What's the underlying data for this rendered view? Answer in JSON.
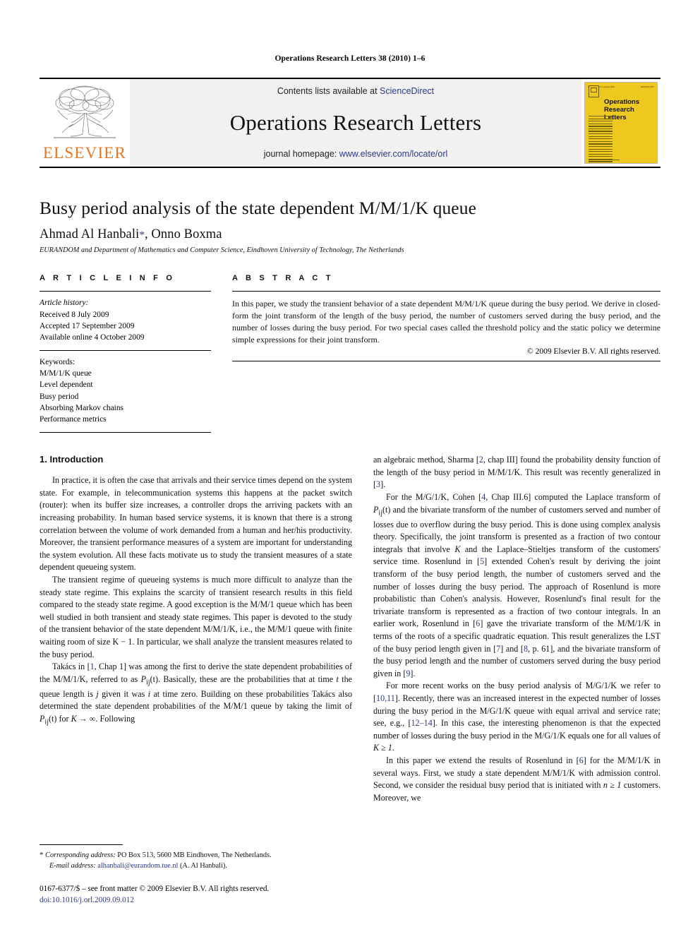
{
  "running_head": "Operations Research Letters 38 (2010) 1–6",
  "masthead": {
    "publisher_wordmark": "ELSEVIER",
    "contents_prefix": "Contents lists available at ",
    "contents_link": "ScienceDirect",
    "journal_title": "Operations Research Letters",
    "homepage_prefix": "journal homepage: ",
    "homepage_link": "www.elsevier.com/locate/orl",
    "cover": {
      "title_line1": "Operations",
      "title_line2": "Research",
      "title_line3": "Letters",
      "top_left": "Volume 38  Issue 1  January 2010",
      "top_right": "ISSN 0167-6377",
      "color": "#EDC81E"
    },
    "accent_orange": "#E87722",
    "link_blue": "#2b3a8f"
  },
  "article": {
    "title": "Busy period analysis of the state dependent M/M/1/K queue",
    "authors": "Ahmad Al Hanbali",
    "author_star": "*",
    "authors_tail": ", Onno Boxma",
    "affiliation": "EURANDOM and Department of Mathematics and Computer Science, Eindhoven University of Technology, The Netherlands"
  },
  "article_info": {
    "heading": "A R T I C L E   I N F O",
    "history_label": "Article history:",
    "history": [
      "Received 8 July 2009",
      "Accepted 17 September 2009",
      "Available online 4 October 2009"
    ],
    "keywords_label": "Keywords:",
    "keywords": [
      "M/M/1/K queue",
      "Level dependent",
      "Busy period",
      "Absorbing Markov chains",
      "Performance metrics"
    ]
  },
  "abstract": {
    "heading": "A B S T R A C T",
    "text": "In this paper, we study the transient behavior of a state dependent M/M/1/K queue during the busy period. We derive in closed-form the joint transform of the length of the busy period, the number of customers served during the busy period, and the number of losses during the busy period. For two special cases called the threshold policy and the static policy we determine simple expressions for their joint transform.",
    "copyright": "© 2009 Elsevier B.V. All rights reserved."
  },
  "body": {
    "section_number_title": "1.  Introduction",
    "left_paragraphs": {
      "p1": "In practice, it is often the case that arrivals and their service times depend on the system state. For example, in telecommunication systems this happens at the packet switch (router): when its buffer size increases, a controller drops the arriving packets with an increasing probability. In human based service systems, it is known that there is a strong correlation between the volume of work demanded from a human and her/his productivity. Moreover, the transient performance measures of a system are important for understanding the system evolution. All these facts motivate us to study the transient measures of a state dependent queueing system.",
      "p2": "The transient regime of queueing systems is much more difficult to analyze than the steady state regime. This explains the scarcity of transient research results in this field compared to the steady state regime. A good exception is the M/M/1 queue which has been well studied in both transient and steady state regimes. This paper is devoted to the study of the transient behavior of the state dependent M/M/1/K, i.e., the M/M/1 queue with finite waiting room of size K − 1. In particular, we shall analyze the transient measures related to the busy period.",
      "p3_a": "Takács in [",
      "p3_ref1": "1",
      "p3_b": ", Chap 1] was among the first to derive the state dependent probabilities of the M/M/1/K, referred to as ",
      "p3_math1": "P",
      "p3_sub1": "ij",
      "p3_math1b": "(t)",
      "p3_c": ". Basically, these are the probabilities that at time ",
      "p3_math2": "t",
      "p3_d": " the queue length is ",
      "p3_math3": "j",
      "p3_e": " given it was ",
      "p3_math4": "i",
      "p3_f": " at time zero. Building on these probabilities Takács also determined the state dependent probabilities of the M/M/1 queue by taking the limit of ",
      "p3_math5": "P",
      "p3_sub5": "ij",
      "p3_math5b": "(t)",
      "p3_g": " for ",
      "p3_math6": "K",
      "p3_arrow": " → ",
      "p3_inf": "∞",
      "p3_h": ". Following"
    },
    "right_paragraphs": {
      "p4_a": "an algebraic method, Sharma [",
      "p4_ref1": "2",
      "p4_b": ", chap III] found the probability density function of the length of the busy period in M/M/1/K. This result was recently generalized in [",
      "p4_ref2": "3",
      "p4_c": "].",
      "p5_a": "For the M/G/1/K, Cohen [",
      "p5_ref1": "4",
      "p5_b": ", Chap III.6] computed the Laplace transform of ",
      "p5_math1": "P",
      "p5_sub1": "ij",
      "p5_math1b": "(t)",
      "p5_c": " and the bivariate transform of the number of customers served and number of losses due to overflow during the busy period. This is done using complex analysis theory. Specifically, the joint transform is presented as a fraction of two contour integrals that involve ",
      "p5_mathK": "K",
      "p5_d": " and the Laplace–Stieltjes transform of the customers' service time. Rosenlund in [",
      "p5_ref2": "5",
      "p5_e": "] extended Cohen's result by deriving the joint transform of the busy period length, the number of customers served and the number of losses during the busy period. The approach of Rosenlund is more probabilistic than Cohen's analysis. However, Rosenlund's final result for the trivariate transform is represented as a fraction of two contour integrals. In an earlier work, Rosenlund in [",
      "p5_ref3": "6",
      "p5_f": "] gave the trivariate transform of the M/M/1/K in terms of the roots of a specific quadratic equation. This result generalizes the LST of the busy period length given in [",
      "p5_ref4": "7",
      "p5_g": "] and [",
      "p5_ref5": "8",
      "p5_h": ", p. 61], and the bivariate transform of the busy period length and the number of customers served during the busy period given in [",
      "p5_ref6": "9",
      "p5_i": "].",
      "p6_a": "For more recent works on the busy period analysis of M/G/1/K we refer to [",
      "p6_ref1": "10,11",
      "p6_b": "]. Recently, there was an increased interest in the expected number of losses during the busy period in the M/G/1/K queue with equal arrival and service rate; see, e.g., [",
      "p6_ref2": "12–14",
      "p6_c": "]. In this case, the interesting phenomenon is that the expected number of losses during the busy period in the M/G/1/K equals one for all values of ",
      "p6_mathK": "K ≥ 1",
      "p6_d": ".",
      "p7_a": "In this paper we extend the results of Rosenlund in [",
      "p7_ref1": "6",
      "p7_b": "] for the M/M/1/K in several ways. First, we study a state dependent M/M/1/K with admission control. Second, we consider the residual busy period that is initiated with ",
      "p7_math": "n ≥ 1",
      "p7_c": " customers. Moreover, we"
    }
  },
  "footnote": {
    "star": "*",
    "corresponding_label": "Corresponding address:",
    "corresponding_text": " PO Box 513, 5600 MB Eindhoven, The Netherlands.",
    "email_label": "E-mail address:",
    "email": "alhanbali@eurandom.tue.nl",
    "email_tail": " (A. Al Hanbali).",
    "issn_line": "0167-6377/$ – see front matter © 2009 Elsevier B.V. All rights reserved.",
    "doi": "doi:10.1016/j.orl.2009.09.012"
  }
}
